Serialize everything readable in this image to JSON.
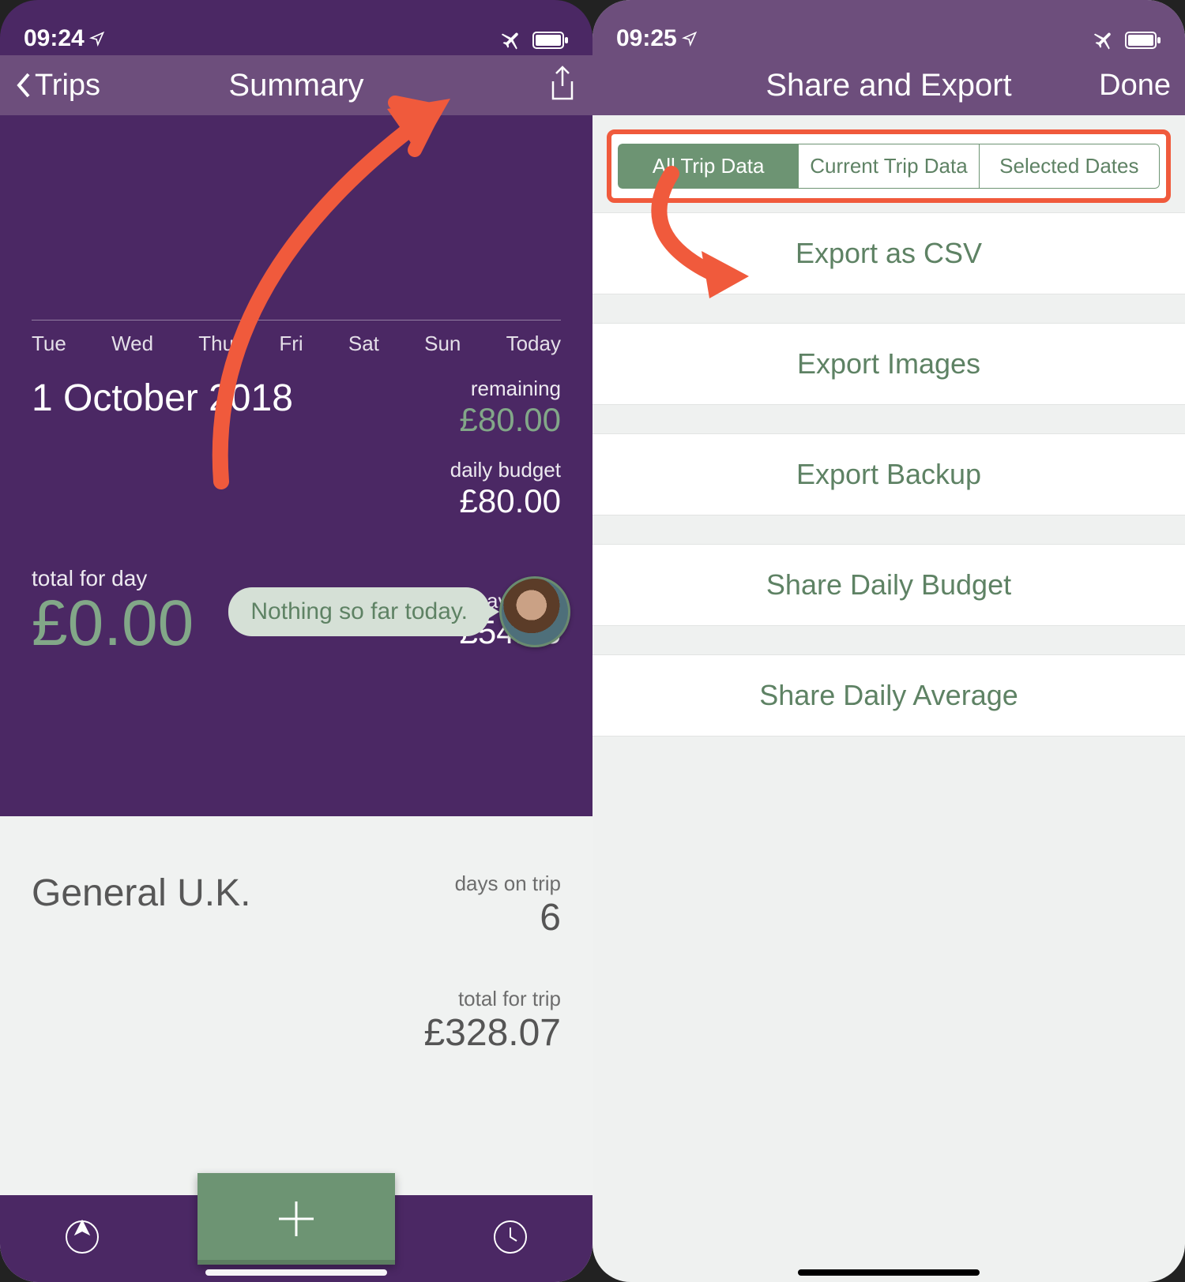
{
  "left": {
    "status_time": "09:24",
    "nav_back": "Trips",
    "nav_title": "Summary",
    "days": [
      "Tue",
      "Wed",
      "Thu",
      "Fri",
      "Sat",
      "Sun",
      "Today"
    ],
    "date": "1 October 2018",
    "remaining_label": "remaining",
    "remaining_value": "£80.00",
    "daily_budget_label": "daily budget",
    "daily_budget_value": "£80.00",
    "total_day_label": "total for day",
    "total_day_value": "£0.00",
    "average_label": "average",
    "average_value": "£54.68",
    "speech": "Nothing so far today.",
    "trip_name": "General U.K.",
    "days_on_trip_label": "days on trip",
    "days_on_trip_value": "6",
    "total_trip_label": "total for trip",
    "total_trip_value": "£328.07"
  },
  "right": {
    "status_time": "09:25",
    "nav_title": "Share and Export",
    "done": "Done",
    "segments": {
      "all": "All Trip Data",
      "current": "Current Trip Data",
      "selected": "Selected Dates"
    },
    "items": {
      "csv": "Export as CSV",
      "images": "Export Images",
      "backup": "Export Backup",
      "daily_budget": "Share Daily Budget",
      "daily_average": "Share Daily Average"
    }
  }
}
